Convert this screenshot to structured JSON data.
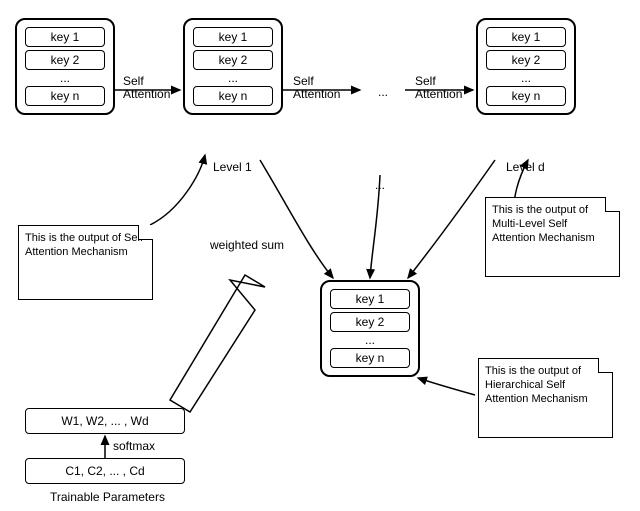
{
  "blocks": {
    "input": {
      "keys": [
        "key 1",
        "key 2",
        "...",
        "key n"
      ]
    },
    "level1": {
      "keys": [
        "key 1",
        "key 2",
        "...",
        "key n"
      ],
      "caption": "Level 1"
    },
    "leveld": {
      "keys": [
        "key 1",
        "key 2",
        "...",
        "key n"
      ],
      "caption": "Level d"
    },
    "output": {
      "keys": [
        "key 1",
        "key 2",
        "...",
        "key n"
      ]
    }
  },
  "arrows": {
    "self_attention": "Self\nAttention",
    "weighted_sum": "weighted sum",
    "softmax": "softmax",
    "ellipsis_top": "...",
    "ellipsis_mid": "..."
  },
  "notes": {
    "sa_output": "This is the output of Self Attention Mechanism",
    "multi_level": "This is the output of Multi-Level Self Attention Mechanism",
    "hierarchical": "This is the output of Hierarchical Self Attention Mechanism"
  },
  "params": {
    "weights": "W1, W2, ... , Wd",
    "coeffs": "C1, C2, ... , Cd",
    "caption": "Trainable Parameters"
  }
}
